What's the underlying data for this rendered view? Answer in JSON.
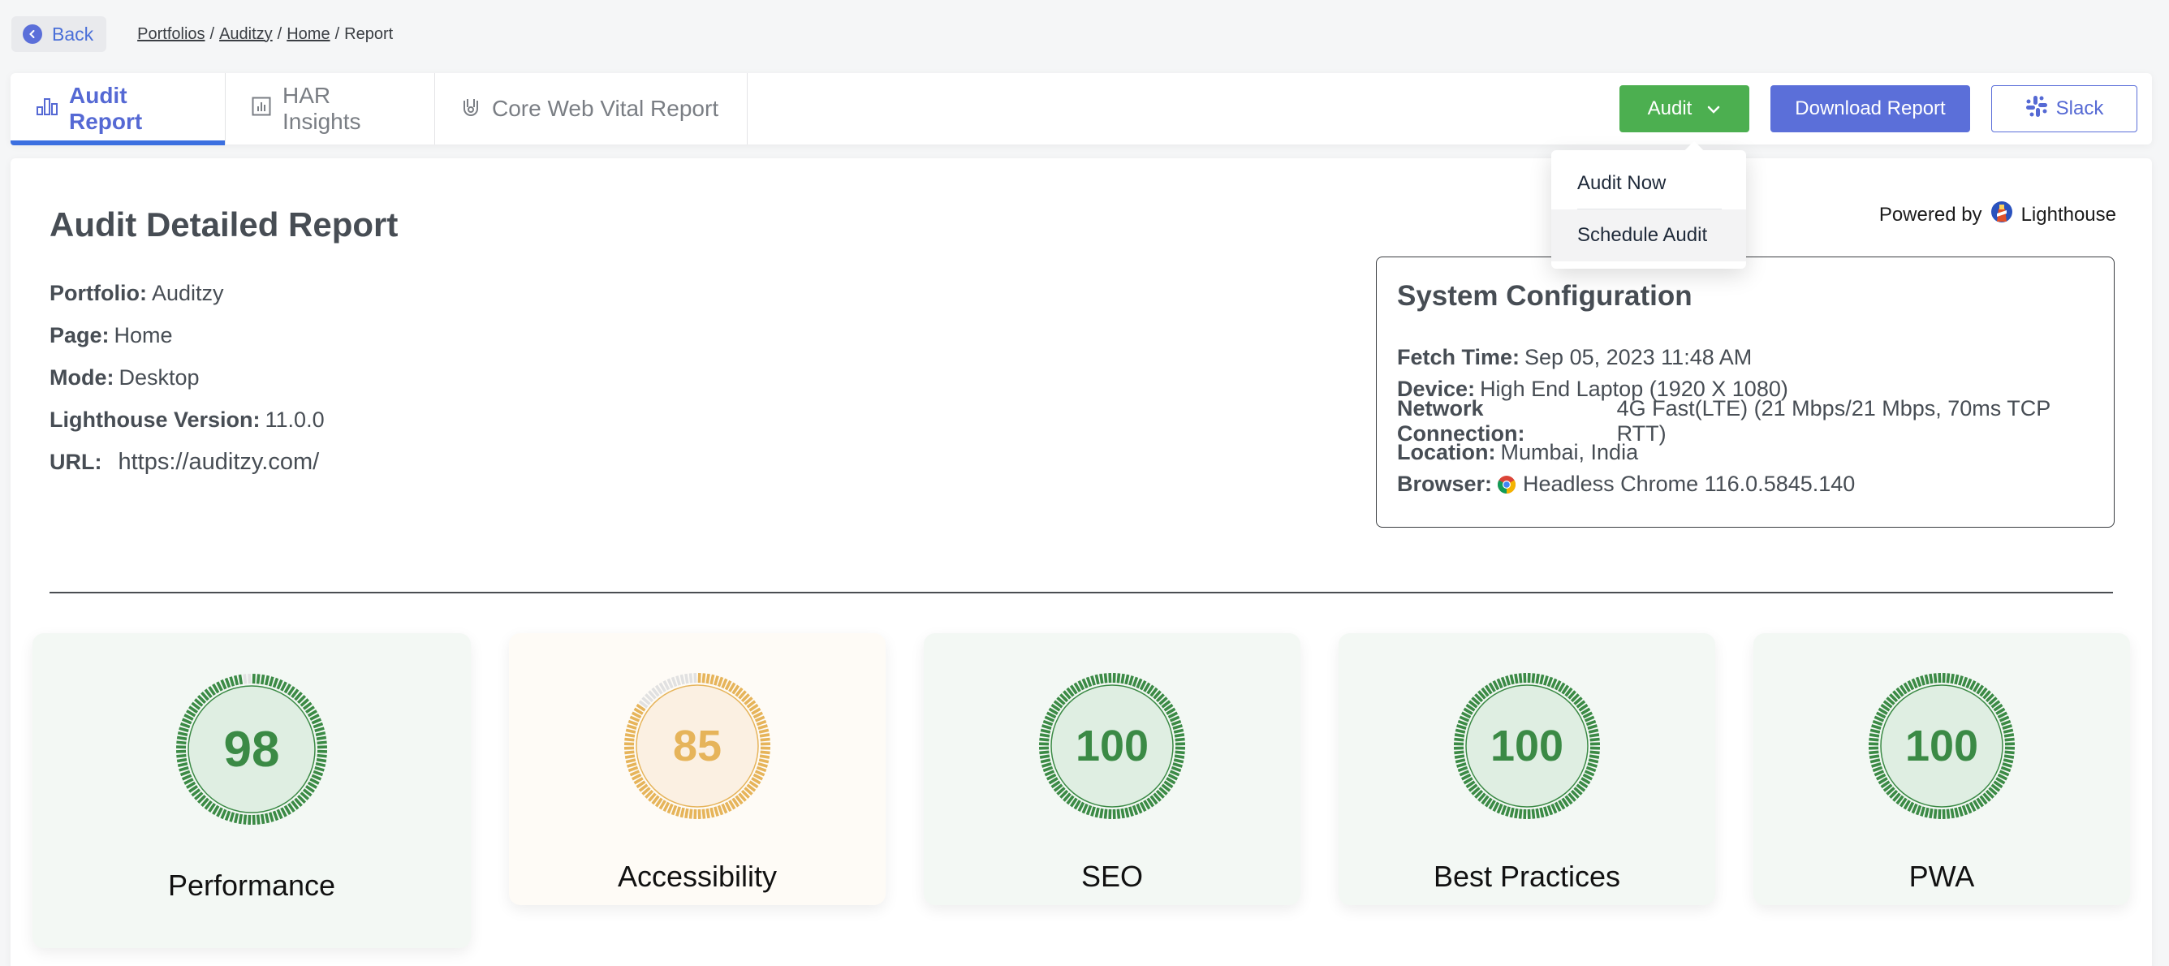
{
  "topbar": {
    "back_label": "Back",
    "breadcrumb": [
      {
        "label": "Portfolios",
        "link": true
      },
      {
        "label": "Auditzy",
        "link": true
      },
      {
        "label": "Home",
        "link": true
      },
      {
        "label": "Report",
        "link": false
      }
    ],
    "separator": "/"
  },
  "tabs": [
    {
      "label": "Audit Report",
      "icon": "bar-chart-icon",
      "active": true
    },
    {
      "label": "HAR Insights",
      "icon": "chart-box-icon",
      "active": false
    },
    {
      "label": "Core Web Vital Report",
      "icon": "hand-rock-icon",
      "active": false
    }
  ],
  "actions": {
    "audit_label": "Audit",
    "download_label": "Download Report",
    "slack_label": "Slack"
  },
  "audit_menu": {
    "items": [
      "Audit Now",
      "Schedule Audit"
    ],
    "hovered": "Schedule Audit"
  },
  "report": {
    "title": "Audit Detailed Report",
    "powered_by_label": "Powered by",
    "powered_by_name": "Lighthouse",
    "details": [
      {
        "label": "Portfolio:",
        "value": "Auditzy"
      },
      {
        "label": "Page:",
        "value": "Home"
      },
      {
        "label": "Mode:",
        "value": "Desktop"
      },
      {
        "label": "Lighthouse Version:",
        "value": "11.0.0"
      },
      {
        "label": "URL:",
        "value": "https://auditzy.com/"
      }
    ]
  },
  "system_config": {
    "title": "System Configuration",
    "rows": [
      {
        "label": "Fetch Time:",
        "value": "Sep 05, 2023 11:48 AM"
      },
      {
        "label": "Device:",
        "value": "High End Laptop (1920 X 1080)"
      },
      {
        "label": "Network Connection:",
        "value": "4G Fast(LTE) (21 Mbps/21 Mbps, 70ms TCP RTT)"
      },
      {
        "label": "Location:",
        "value": "Mumbai, India"
      },
      {
        "label": "Browser:",
        "value": "Headless Chrome 116.0.5845.140"
      }
    ]
  },
  "scores": [
    {
      "label": "Performance",
      "score": 98,
      "color": "#3b8a45",
      "fill": "#dfeee2",
      "track": "#e1e1e1"
    },
    {
      "label": "Accessibility",
      "score": 85,
      "color": "#e6b45a",
      "fill": "#fbf0e2",
      "track": "#e1e1e1"
    },
    {
      "label": "SEO",
      "score": 100,
      "color": "#3b8a45",
      "fill": "#dfeee2",
      "track": "#e1e1e1"
    },
    {
      "label": "Best Practices",
      "score": 100,
      "color": "#3b8a45",
      "fill": "#dfeee2",
      "track": "#e1e1e1"
    },
    {
      "label": "PWA",
      "score": 100,
      "color": "#3b8a45",
      "fill": "#dfeee2",
      "track": "#e1e1e1"
    }
  ]
}
